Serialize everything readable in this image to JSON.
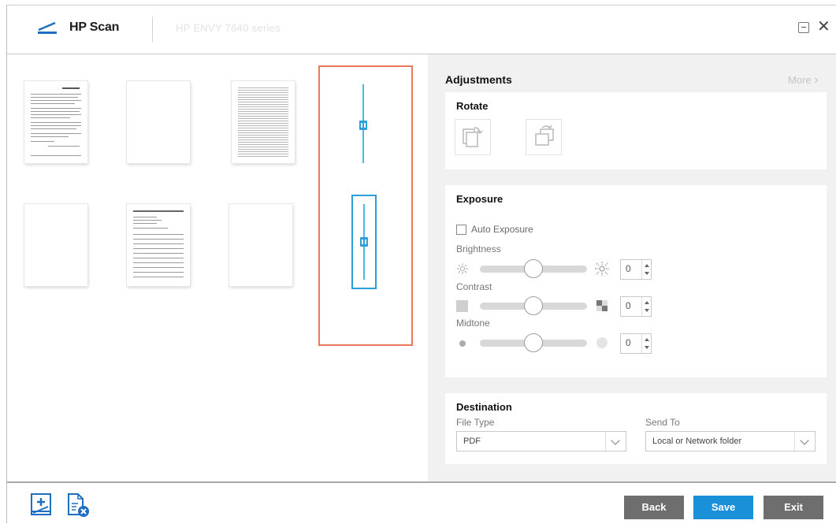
{
  "titlebar": {
    "app_title": "HP Scan",
    "device_name": "HP ENVY 7640 series",
    "logo_icon": "scanner-logo-icon",
    "minimize_icon": "minimize-icon",
    "close_icon": "close-icon",
    "close_glyph": "✕"
  },
  "preview": {
    "thumbnails": [
      "document-page-icon",
      "blank-page-icon",
      "dense-text-page-icon",
      "blank-page-icon",
      "form-page-icon",
      "blank-page-icon"
    ],
    "selection_color": "#e8795a",
    "split_color": "#2a9fd8"
  },
  "adjustments": {
    "title": "Adjustments",
    "more_label": "More",
    "more_glyph": "›",
    "rotate": {
      "title": "Rotate",
      "buttons": [
        "rotate-left-icon",
        "rotate-right-icon"
      ]
    },
    "exposure": {
      "title": "Exposure",
      "auto_exposure_label": "Auto Exposure",
      "auto_exposure_checked": false,
      "brightness": {
        "label": "Brightness",
        "value": "0",
        "level": 0.5
      },
      "contrast": {
        "label": "Contrast",
        "value": "0",
        "level": 0.5
      },
      "midtone": {
        "label": "Midtone",
        "value": "0",
        "level": 0.5
      }
    },
    "destination": {
      "title": "Destination",
      "file_type_label": "File Type",
      "file_type_value": "PDF",
      "send_to_label": "Send To",
      "send_to_value": "Local or Network folder"
    }
  },
  "bottombar": {
    "add_page_icon": "add-page-icon",
    "delete_page_icon": "delete-page-icon",
    "back_label": "Back",
    "save_label": "Save",
    "exit_label": "Exit",
    "save_color": "#1a90d8",
    "secondary_color": "#6e6e6e"
  }
}
